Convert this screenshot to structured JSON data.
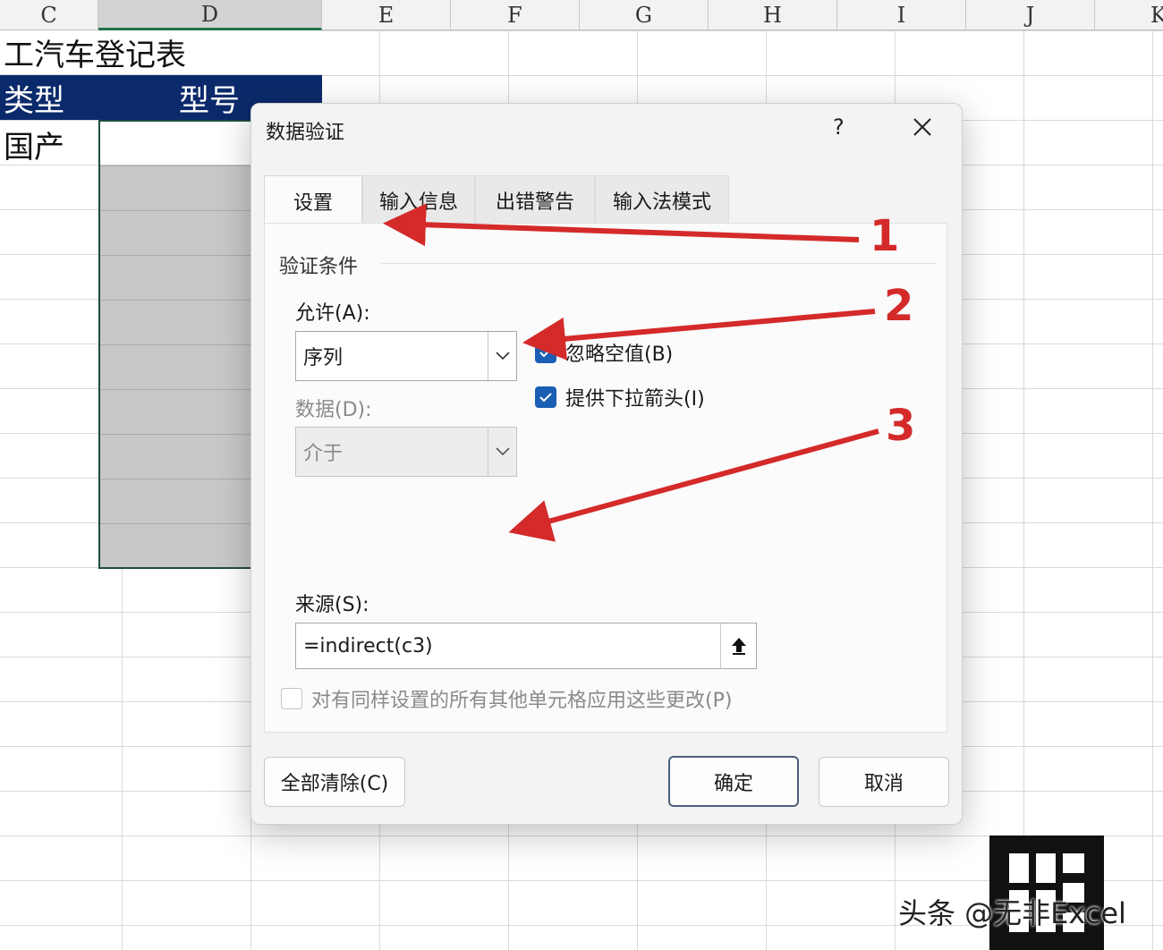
{
  "sheet": {
    "columns": [
      "C",
      "D",
      "E",
      "F",
      "G",
      "H",
      "I",
      "J",
      "K"
    ],
    "selected_column": "D",
    "title_cell": "工汽车登记表",
    "header_type": "类型",
    "header_model": "型号",
    "cell_c4": "国产"
  },
  "dialog": {
    "title": "数据验证",
    "help": "?",
    "tabs": [
      "设置",
      "输入信息",
      "出错警告",
      "输入法模式"
    ],
    "active_tab": "设置",
    "group_label": "验证条件",
    "allow_label": "允许(A):",
    "allow_value": "序列",
    "data_label": "数据(D):",
    "data_value": "介于",
    "ignore_blank_label": "忽略空值(B)",
    "ignore_blank_checked": true,
    "dropdown_label": "提供下拉箭头(I)",
    "dropdown_checked": true,
    "source_label": "来源(S):",
    "source_value": "=indirect(c3)",
    "apply_all_label": "对有同样设置的所有其他单元格应用这些更改(P)",
    "apply_all_checked": false,
    "clear_all_label": "全部清除(C)",
    "ok_label": "确定",
    "cancel_label": "取消"
  },
  "annotations": [
    "1",
    "2",
    "3"
  ],
  "colors": {
    "annotation_red": "#d42a2a",
    "header_fill": "#0b2a6b",
    "checkbox_blue": "#1a5fb4",
    "selection_green": "#217346"
  },
  "watermark": {
    "text": "头条 @无非Excel"
  }
}
